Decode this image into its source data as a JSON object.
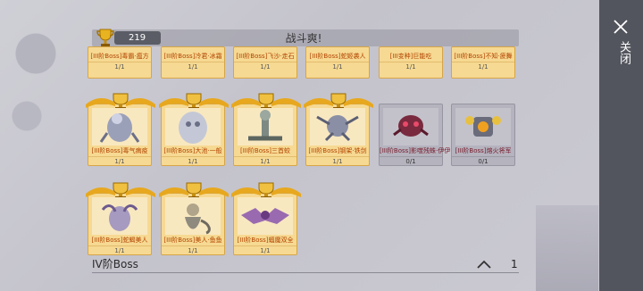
{
  "header": {
    "count": "219",
    "title": "战斗爽!"
  },
  "sidebar": {
    "close_label": "关闭"
  },
  "row_top": [
    {
      "name": "[III阶Boss]毒霸·瘟方",
      "ratio": "1/1"
    },
    {
      "name": "[III阶Boss]冷君·冰霜",
      "ratio": "1/1"
    },
    {
      "name": "[III阶Boss]飞沙·走石",
      "ratio": "1/1"
    },
    {
      "name": "[III阶Boss]蛇姬袭人",
      "ratio": "1/1"
    },
    {
      "name": "[III变种]巨能吃",
      "ratio": "1/1"
    },
    {
      "name": "[III阶Boss]不知·疲舞",
      "ratio": "1/1"
    }
  ],
  "row_mid": [
    {
      "name": "[III阶Boss]毒气病疫",
      "ratio": "1/1",
      "locked": false
    },
    {
      "name": "[III阶Boss]大池·一般",
      "ratio": "1/1",
      "locked": false
    },
    {
      "name": "[III阶Boss]三首蛟",
      "ratio": "1/1",
      "locked": false
    },
    {
      "name": "[III阶Boss]钢架·铁剑",
      "ratio": "1/1",
      "locked": false
    },
    {
      "name": "[III阶Boss]影噬残蛛·伊伊",
      "ratio": "0/1",
      "locked": true
    },
    {
      "name": "[III阶Boss]熔火将军",
      "ratio": "0/1",
      "locked": true
    }
  ],
  "row_bottom": [
    {
      "name": "[III阶Boss]蛇蝎美人",
      "ratio": "1/1"
    },
    {
      "name": "[III阶Boss]美人·鱼鱼",
      "ratio": "1/1"
    },
    {
      "name": "[III阶Boss]蝠魔双全",
      "ratio": "1/1"
    }
  ],
  "section": {
    "title": "IV阶Boss",
    "count": "1"
  },
  "colors": {
    "card_bg": "#f6d992",
    "card_border": "#d6a548",
    "locked_bg": "#b4b3be",
    "panel": "#53555e",
    "name_text": "#b24400"
  },
  "icons": {
    "trophy": "trophy-icon",
    "laurel": "laurel-trophy-icon",
    "close": "close-icon",
    "collapse": "chevron-up-icon"
  }
}
